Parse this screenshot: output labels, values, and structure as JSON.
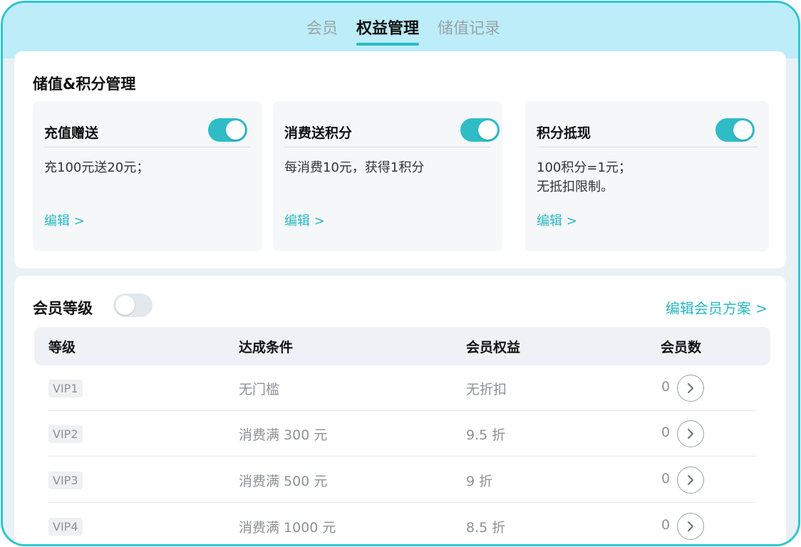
{
  "tabs": [
    {
      "label": "会员",
      "active": false
    },
    {
      "label": "权益管理",
      "active": true
    },
    {
      "label": "储值记录",
      "active": false
    }
  ],
  "stored_value_section": {
    "title": "储值&积分管理",
    "features": [
      {
        "name": "充值赠送",
        "enabled": true,
        "description": "充100元送20元；",
        "edit_label": "编辑 >"
      },
      {
        "name": "消费送积分",
        "enabled": true,
        "description": "每消费10元，获得1积分",
        "edit_label": "编辑 >"
      },
      {
        "name": "积分抵现",
        "enabled": true,
        "description": "100积分=1元；\n无抵扣限制。",
        "edit_label": "编辑 >"
      }
    ]
  },
  "member_level_section": {
    "title": "会员等级",
    "enabled": false,
    "edit_plan_label": "编辑会员方案 >",
    "columns": [
      "等级",
      "达成条件",
      "会员权益",
      "会员数"
    ],
    "rows": [
      {
        "level": "VIP1",
        "condition": "无门槛",
        "benefit": "无折扣",
        "members": "0"
      },
      {
        "level": "VIP2",
        "condition": "消费满 300 元",
        "benefit": "9.5 折",
        "members": "0"
      },
      {
        "level": "VIP3",
        "condition": "消费满 500 元",
        "benefit": "9 折",
        "members": "0"
      },
      {
        "level": "VIP4",
        "condition": "消费满 1000 元",
        "benefit": "8.5 折",
        "members": "0"
      }
    ]
  },
  "colors": {
    "accent": "#2fbcc6",
    "topbar": "#bcedf8",
    "frame_border": "#2fc6d0"
  },
  "icons": {
    "row_action": "chevron-right-circle-icon"
  }
}
